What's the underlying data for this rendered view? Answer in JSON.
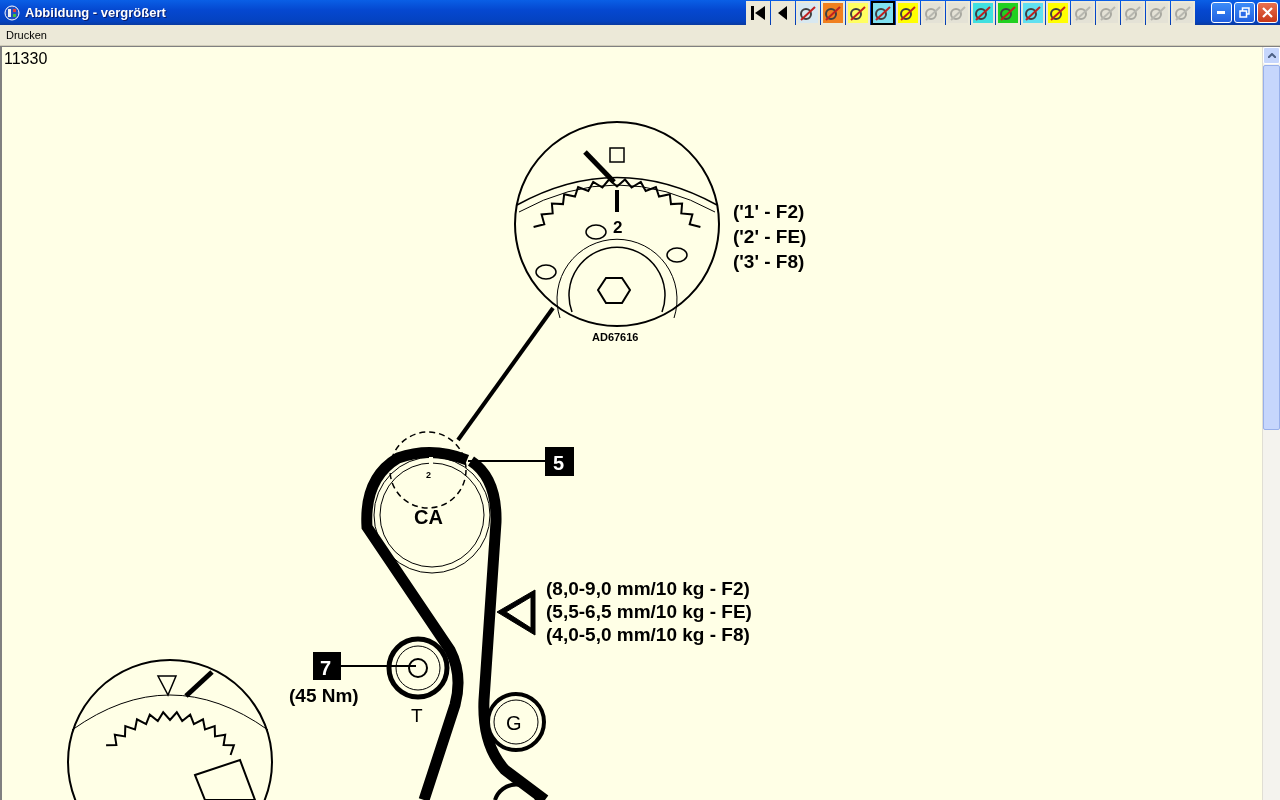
{
  "window": {
    "title": "Abbildung - vergrößert"
  },
  "toolbar": [
    {
      "kind": "first",
      "disabled": false,
      "selected": false
    },
    {
      "kind": "previous",
      "disabled": false,
      "selected": false
    },
    {
      "kind": "image",
      "disabled": false,
      "selected": false,
      "color": "#d8e8f0"
    },
    {
      "kind": "image",
      "disabled": false,
      "selected": false,
      "color": "#f08020"
    },
    {
      "kind": "image",
      "disabled": false,
      "selected": false,
      "color": "#ffff60"
    },
    {
      "kind": "image",
      "disabled": false,
      "selected": true,
      "color": "#80e0f0"
    },
    {
      "kind": "image",
      "disabled": false,
      "selected": false,
      "color": "#ffff00"
    },
    {
      "kind": "image",
      "disabled": true,
      "selected": false
    },
    {
      "kind": "image",
      "disabled": true,
      "selected": false
    },
    {
      "kind": "image",
      "disabled": false,
      "selected": false,
      "color": "#40e0e0"
    },
    {
      "kind": "image",
      "disabled": false,
      "selected": false,
      "color": "#20d020"
    },
    {
      "kind": "image",
      "disabled": false,
      "selected": false,
      "color": "#60e0f0"
    },
    {
      "kind": "image",
      "disabled": false,
      "selected": false,
      "color": "#ffff00"
    },
    {
      "kind": "image",
      "disabled": true,
      "selected": false
    },
    {
      "kind": "image",
      "disabled": true,
      "selected": false
    },
    {
      "kind": "image",
      "disabled": true,
      "selected": false
    },
    {
      "kind": "image",
      "disabled": true,
      "selected": false
    },
    {
      "kind": "image",
      "disabled": true,
      "selected": false
    }
  ],
  "menu": [
    "Drucken"
  ],
  "figure": {
    "number": "11330",
    "diagram": {
      "camshaft_mark": "2",
      "variant_codes": [
        "('1' - F2)",
        "('2' - FE)",
        "('3' - F8)"
      ],
      "reference": "AD67616",
      "belt_mark": "2",
      "callout_belt": "5",
      "camshaft_pulley": "CA",
      "tension_specs": [
        "(8,0-9,0 mm/10 kg - F2)",
        "(5,5-6,5 mm/10 kg - FE)",
        "(4,0-5,0 mm/10 kg - F8)"
      ],
      "callout_tensioner": "7",
      "torque": "(45 Nm)",
      "tensioner": "T",
      "idler": "G"
    }
  }
}
